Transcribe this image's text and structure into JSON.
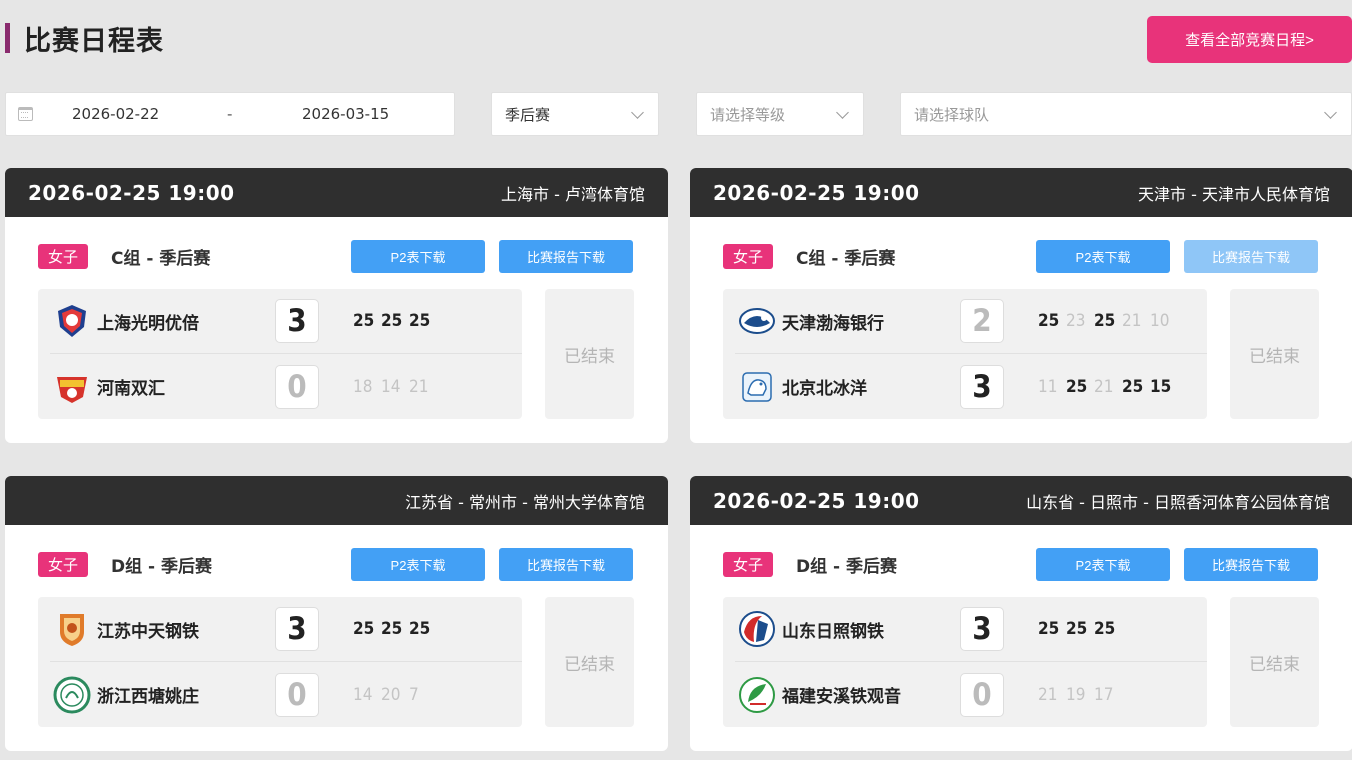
{
  "page": {
    "title": "比赛日程表",
    "all_schedule_button": "查看全部竞赛日程>"
  },
  "filters": {
    "date_start": "2026-02-22",
    "date_separator": "-",
    "date_end": "2026-03-15",
    "stage_value": "季后赛",
    "level_placeholder": "请选择等级",
    "team_placeholder": "请选择球队"
  },
  "matches": [
    {
      "time": "2026-02-25 19:00",
      "venue": "上海市 - 卢湾体育馆",
      "gender": "女子",
      "group": "C组 - 季后赛",
      "p2_label": "P2表下载",
      "report_label": "比赛报告下载",
      "status": "已结束",
      "home": {
        "name": "上海光明优倍",
        "score": "3",
        "sets": [
          "25",
          "25",
          "25"
        ],
        "logo_color": "#1f3f8f"
      },
      "away": {
        "name": "河南双汇",
        "score": "0",
        "sets": [
          "18",
          "14",
          "21"
        ],
        "logo_color": "#d6332b"
      }
    },
    {
      "time": "2026-02-25 19:00",
      "venue": "天津市 - 天津市人民体育馆",
      "gender": "女子",
      "group": "C组 - 季后赛",
      "p2_label": "P2表下载",
      "report_label": "比赛报告下载",
      "status": "已结束",
      "home": {
        "name": "天津渤海银行",
        "score": "2",
        "sets": [
          "25",
          "23",
          "25",
          "21",
          "10"
        ],
        "logo_color": "#1c4d8c"
      },
      "away": {
        "name": "北京北冰洋",
        "score": "3",
        "sets": [
          "11",
          "25",
          "21",
          "25",
          "15"
        ],
        "logo_color": "#2b6cb0"
      }
    },
    {
      "time": "",
      "venue": "江苏省 - 常州市 - 常州大学体育馆",
      "gender": "女子",
      "group": "D组 - 季后赛",
      "p2_label": "P2表下载",
      "report_label": "比赛报告下载",
      "status": "已结束",
      "home": {
        "name": "江苏中天钢铁",
        "score": "3",
        "sets": [
          "25",
          "25",
          "25"
        ],
        "logo_color": "#e07b2a"
      },
      "away": {
        "name": "浙江西塘姚庄",
        "score": "0",
        "sets": [
          "14",
          "20",
          "7"
        ],
        "logo_color": "#2b8a5e"
      }
    },
    {
      "time": "2026-02-25 19:00",
      "venue": "山东省 - 日照市 - 日照香河体育公园体育馆",
      "gender": "女子",
      "group": "D组 - 季后赛",
      "p2_label": "P2表下载",
      "report_label": "比赛报告下载",
      "status": "已结束",
      "home": {
        "name": "山东日照钢铁",
        "score": "3",
        "sets": [
          "25",
          "25",
          "25"
        ],
        "logo_color": "#d12b2b"
      },
      "away": {
        "name": "福建安溪铁观音",
        "score": "0",
        "sets": [
          "21",
          "19",
          "17"
        ],
        "logo_color": "#2e9a44"
      }
    }
  ]
}
